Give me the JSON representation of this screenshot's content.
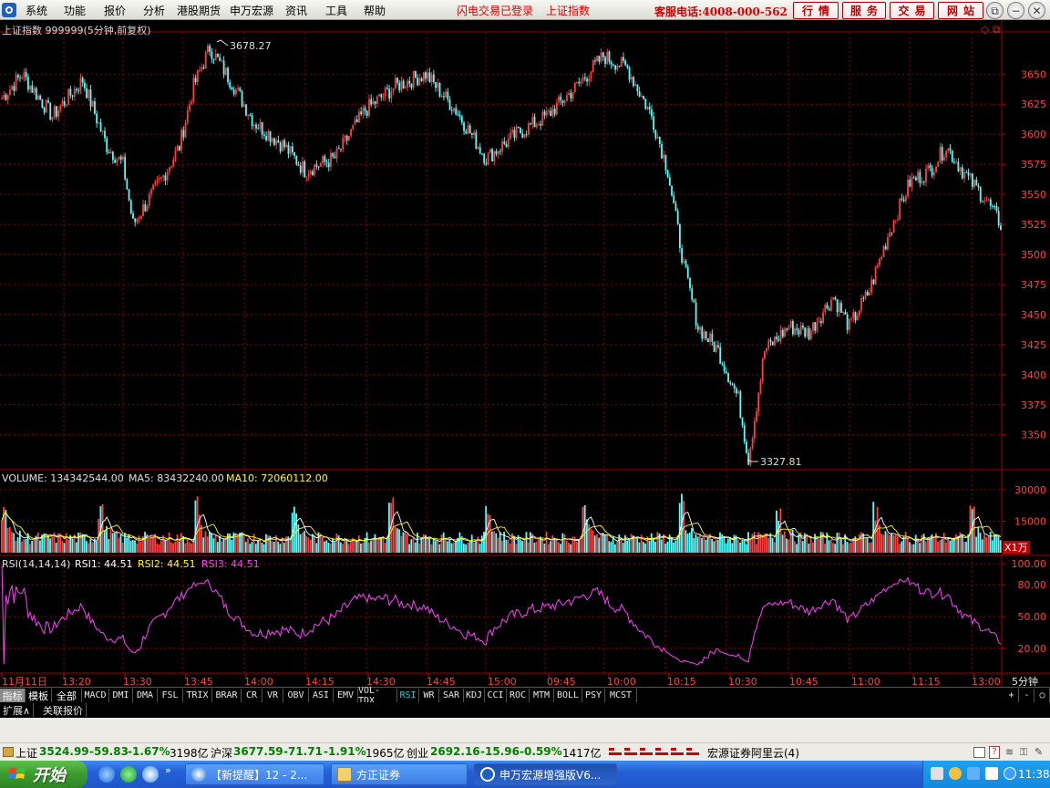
{
  "menu": {
    "items": [
      "系统",
      "功能",
      "报价",
      "分析",
      "港股期货",
      "申万宏源",
      "资讯",
      "工具",
      "帮助"
    ],
    "flash_status": "闪电交易已登录",
    "current_index": "上证指数",
    "hotline": "客服电话:4008-000-562",
    "nav_buttons": [
      "行情",
      "服务",
      "交易",
      "网站"
    ],
    "window_buttons": [
      "⧉",
      "−",
      "✕"
    ]
  },
  "chart_header": {
    "title": "上证指数 999999(5分钟,前复权)",
    "high_label": "3678.27",
    "low_label": "3327.81"
  },
  "volume_header": {
    "volume": "VOLUME: 134342544.00",
    "ma5": "MA5: 83432240.00",
    "ma10": "MA10: 72060112.00",
    "unit": "X1万"
  },
  "rsi_header": {
    "params": "RSI(14,14,14)",
    "rsi1": "RSI1: 44.51",
    "rsi2": "RSI2: 44.51",
    "rsi3": "RSI3: 44.51"
  },
  "time_axis": {
    "labels": [
      "11月11日",
      "13:20",
      "13:30",
      "13:45",
      "14:00",
      "14:15",
      "14:30",
      "14:45",
      "15:00",
      "09:45",
      "10:00",
      "10:15",
      "10:30",
      "10:45",
      "11:00",
      "11:15",
      "13:00"
    ],
    "period": "5分钟"
  },
  "indicator_tabs": [
    "指标",
    "模板",
    "全部",
    "MACD",
    "DMI",
    "DMA",
    "FSL",
    "TRIX",
    "BRAR",
    "CR",
    "VR",
    "OBV",
    "ASI",
    "EMV",
    "VOL-TDX",
    "RSI",
    "WR",
    "SAR",
    "KDJ",
    "CCI",
    "ROC",
    "MTM",
    "BOLL",
    "PSY",
    "MCST"
  ],
  "active_indicator": "RSI",
  "zoom_buttons": [
    "+",
    "-",
    "○"
  ],
  "sub_tabs": [
    "扩展∧",
    "关联报价"
  ],
  "status": {
    "sh_name": "上证",
    "sh_value": "3524.99",
    "sh_change": "-59.83",
    "sh_pct": "-1.67%",
    "sh_amount": "3198亿",
    "hs_name": "沪深",
    "hs_value": "3677.59",
    "hs_change": "-71.71",
    "hs_pct": "-1.91%",
    "hs_amount": "1965亿",
    "cy_name": "创业",
    "cy_value": "2692.16",
    "cy_change": "-15.96",
    "cy_pct": "-0.59%",
    "cy_amount": "1417亿",
    "server": "宏源证券阿里云(4)"
  },
  "taskbar": {
    "start": "开始",
    "tasks": [
      "【新提醒】12 - 2...",
      "方正证券",
      "申万宏源增强版V6..."
    ],
    "clock": "11:38"
  },
  "colors": {
    "up": "#ff4040",
    "down": "#54ffff",
    "grid": "#8a0000",
    "ma5": "#ffffff",
    "ma10": "#ffff00",
    "rsi": "#ff40ff"
  },
  "chart_data": [
    {
      "type": "candlestick",
      "title": "上证指数 999999(5分钟,前复权)",
      "y_ticks": [
        3650,
        3625,
        3600,
        3575,
        3550,
        3525,
        3500,
        3475,
        3450,
        3425,
        3400,
        3375,
        3350
      ],
      "ylim": [
        3327.81,
        3678.27
      ],
      "keypoints": [
        {
          "t": 0,
          "v": 3630
        },
        {
          "t": 10,
          "v": 3650
        },
        {
          "t": 25,
          "v": 3615
        },
        {
          "t": 40,
          "v": 3645
        },
        {
          "t": 52,
          "v": 3590
        },
        {
          "t": 60,
          "v": 3575
        },
        {
          "t": 65,
          "v": 3525
        },
        {
          "t": 80,
          "v": 3565
        },
        {
          "t": 88,
          "v": 3590
        },
        {
          "t": 95,
          "v": 3640
        },
        {
          "t": 103,
          "v": 3672
        },
        {
          "t": 115,
          "v": 3640
        },
        {
          "t": 125,
          "v": 3610
        },
        {
          "t": 140,
          "v": 3590
        },
        {
          "t": 150,
          "v": 3570
        },
        {
          "t": 165,
          "v": 3580
        },
        {
          "t": 180,
          "v": 3620
        },
        {
          "t": 195,
          "v": 3640
        },
        {
          "t": 210,
          "v": 3650
        },
        {
          "t": 225,
          "v": 3620
        },
        {
          "t": 240,
          "v": 3580
        },
        {
          "t": 255,
          "v": 3600
        },
        {
          "t": 270,
          "v": 3615
        },
        {
          "t": 285,
          "v": 3640
        },
        {
          "t": 298,
          "v": 3665
        },
        {
          "t": 310,
          "v": 3655
        },
        {
          "t": 322,
          "v": 3615
        },
        {
          "t": 330,
          "v": 3570
        },
        {
          "t": 338,
          "v": 3490
        },
        {
          "t": 345,
          "v": 3440
        },
        {
          "t": 355,
          "v": 3420
        },
        {
          "t": 365,
          "v": 3380
        },
        {
          "t": 370,
          "v": 3330
        },
        {
          "t": 378,
          "v": 3420
        },
        {
          "t": 390,
          "v": 3440
        },
        {
          "t": 400,
          "v": 3435
        },
        {
          "t": 412,
          "v": 3465
        },
        {
          "t": 420,
          "v": 3440
        },
        {
          "t": 430,
          "v": 3470
        },
        {
          "t": 440,
          "v": 3520
        },
        {
          "t": 450,
          "v": 3560
        },
        {
          "t": 460,
          "v": 3570
        },
        {
          "t": 468,
          "v": 3590
        },
        {
          "t": 478,
          "v": 3565
        },
        {
          "t": 488,
          "v": 3545
        },
        {
          "t": 495,
          "v": 3525
        }
      ]
    },
    {
      "type": "bar",
      "title": "VOLUME",
      "y_ticks": [
        30000,
        15000
      ],
      "ylim": [
        0,
        33000
      ],
      "unit": "X1万"
    },
    {
      "type": "line",
      "title": "RSI(14,14,14)",
      "y_ticks": [
        100.0,
        80.0,
        50.0,
        20.0
      ],
      "ylim": [
        0,
        100
      ]
    }
  ]
}
